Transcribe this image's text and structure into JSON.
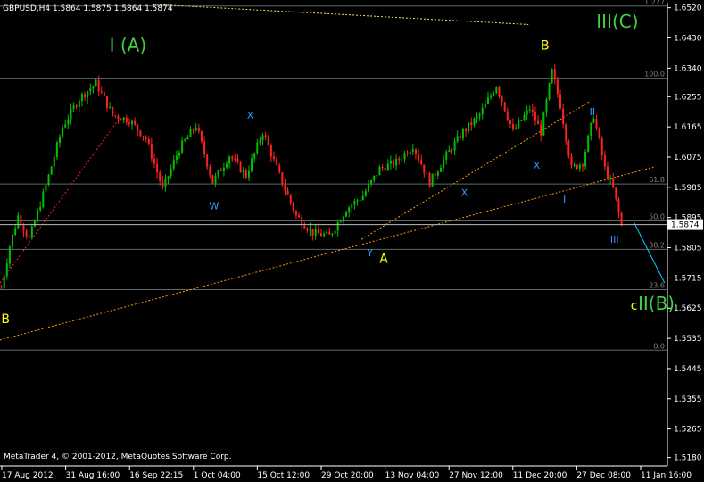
{
  "header": {
    "symbol_info": "GBPUSD,H4  1.5864 1.5875 1.5864 1.5874"
  },
  "copyright": "MetaTrader 4, © 2001-2012, MetaQuotes Software Corp.",
  "current_price": "1.5874",
  "colors": {
    "bull": "#00c000",
    "bear": "#ff2020",
    "grid": "#5a6a6a",
    "background": "#000000"
  },
  "chart_data": {
    "type": "candlestick",
    "price_axis": {
      "min": 1.5155,
      "max": 1.6535,
      "ticks": [
        "1.6520",
        "1.6430",
        "1.6340",
        "1.6255",
        "1.6165",
        "1.6075",
        "1.5985",
        "1.5895",
        "1.5805",
        "1.5715",
        "1.5625",
        "1.5535",
        "1.5445",
        "1.5355",
        "1.5265",
        "1.5180"
      ]
    },
    "time_axis": {
      "ticks": [
        "17 Aug 2012",
        "31 Aug 16:00",
        "16 Sep 22:15",
        "1 Oct 04:00",
        "15 Oct 12:00",
        "29 Oct 20:00",
        "13 Nov 04:00",
        "27 Nov 12:00",
        "11 Dec 20:00",
        "27 Dec 08:00",
        "11 Jan 16:00"
      ]
    },
    "fib_levels": [
      {
        "label": "1.227",
        "price": 1.6525
      },
      {
        "label": "100.0",
        "price": 1.631
      },
      {
        "label": "61.8",
        "price": 1.5995
      },
      {
        "label": "50.0",
        "price": 1.5885
      },
      {
        "label": "38.2",
        "price": 1.58
      },
      {
        "label": "23.6",
        "price": 1.568
      },
      {
        "label": "0.0",
        "price": 1.55
      }
    ],
    "wave_path": [
      {
        "t": 0,
        "p": 1.5685
      },
      {
        "t": 3,
        "p": 1.581
      },
      {
        "t": 6,
        "p": 1.59
      },
      {
        "t": 10,
        "p": 1.583
      },
      {
        "t": 16,
        "p": 1.599
      },
      {
        "t": 22,
        "p": 1.6165
      },
      {
        "t": 28,
        "p": 1.625
      },
      {
        "t": 34,
        "p": 1.6295
      },
      {
        "t": 40,
        "p": 1.62
      },
      {
        "t": 46,
        "p": 1.6185
      },
      {
        "t": 52,
        "p": 1.613
      },
      {
        "t": 58,
        "p": 1.598
      },
      {
        "t": 64,
        "p": 1.61
      },
      {
        "t": 70,
        "p": 1.617
      },
      {
        "t": 76,
        "p": 1.6
      },
      {
        "t": 82,
        "p": 1.608
      },
      {
        "t": 88,
        "p": 1.602
      },
      {
        "t": 94,
        "p": 1.615
      },
      {
        "t": 100,
        "p": 1.602
      },
      {
        "t": 106,
        "p": 1.59
      },
      {
        "t": 112,
        "p": 1.585
      },
      {
        "t": 118,
        "p": 1.584
      },
      {
        "t": 124,
        "p": 1.592
      },
      {
        "t": 130,
        "p": 1.596
      },
      {
        "t": 136,
        "p": 1.604
      },
      {
        "t": 142,
        "p": 1.606
      },
      {
        "t": 148,
        "p": 1.611
      },
      {
        "t": 154,
        "p": 1.6
      },
      {
        "t": 160,
        "p": 1.608
      },
      {
        "t": 166,
        "p": 1.615
      },
      {
        "t": 172,
        "p": 1.62
      },
      {
        "t": 178,
        "p": 1.629
      },
      {
        "t": 184,
        "p": 1.615
      },
      {
        "t": 190,
        "p": 1.622
      },
      {
        "t": 194,
        "p": 1.615
      },
      {
        "t": 198,
        "p": 1.633
      },
      {
        "t": 201,
        "p": 1.623
      },
      {
        "t": 205,
        "p": 1.604
      },
      {
        "t": 209,
        "p": 1.606
      },
      {
        "t": 213,
        "p": 1.62
      },
      {
        "t": 217,
        "p": 1.604
      },
      {
        "t": 220,
        "p": 1.598
      },
      {
        "t": 223,
        "p": 1.587
      }
    ],
    "annotations": [
      {
        "text": "I (A)",
        "t": 46,
        "p": 1.639,
        "color": "#40d040",
        "size": 20
      },
      {
        "text": "III(C)",
        "t": 222,
        "p": 1.646,
        "color": "#40d040",
        "size": 20
      },
      {
        "text": "II(B)",
        "t": 236,
        "p": 1.562,
        "color": "#40d040",
        "size": 20
      },
      {
        "text": "B",
        "t": 196,
        "p": 1.6395,
        "color": "#ffff00",
        "size": 14
      },
      {
        "text": "B",
        "t": 2,
        "p": 1.558,
        "color": "#ffff00",
        "size": 14
      },
      {
        "text": "A",
        "t": 138,
        "p": 1.576,
        "color": "#ffff00",
        "size": 14
      },
      {
        "text": "c",
        "t": 228,
        "p": 1.562,
        "color": "#ffff00",
        "size": 14
      },
      {
        "text": "X",
        "t": 90,
        "p": 1.619,
        "color": "#3399ff",
        "size": 11
      },
      {
        "text": "W",
        "t": 77,
        "p": 1.592,
        "color": "#3399ff",
        "size": 11
      },
      {
        "text": "Y",
        "t": 133,
        "p": 1.578,
        "color": "#3399ff",
        "size": 11
      },
      {
        "text": "X",
        "t": 167,
        "p": 1.596,
        "color": "#3399ff",
        "size": 11
      },
      {
        "text": "X",
        "t": 193,
        "p": 1.604,
        "color": "#3399ff",
        "size": 11
      },
      {
        "text": "I",
        "t": 203,
        "p": 1.594,
        "color": "#3399ff",
        "size": 11
      },
      {
        "text": "II",
        "t": 213,
        "p": 1.62,
        "color": "#3399ff",
        "size": 11
      },
      {
        "text": "III",
        "t": 221,
        "p": 1.582,
        "color": "#3399ff",
        "size": 11
      }
    ],
    "trend_lines": [
      {
        "t1": 0,
        "p1": 1.553,
        "t2": 235,
        "p2": 1.6045,
        "color": "#ff9900",
        "dash": true
      },
      {
        "t1": 130,
        "p1": 1.583,
        "t2": 212,
        "p2": 1.624,
        "color": "#ff9900",
        "dash": true
      },
      {
        "t1": 0,
        "p1": 1.57,
        "t2": 42,
        "p2": 1.618,
        "color": "#ff2020",
        "dash": true
      },
      {
        "t1": 55,
        "p1": 1.653,
        "t2": 190,
        "p2": 1.647,
        "color": "#ffdd55",
        "dash": true
      },
      {
        "t1": 228,
        "p1": 1.588,
        "t2": 239,
        "p2": 1.57,
        "color": "#00ccff",
        "dash": false
      }
    ]
  }
}
